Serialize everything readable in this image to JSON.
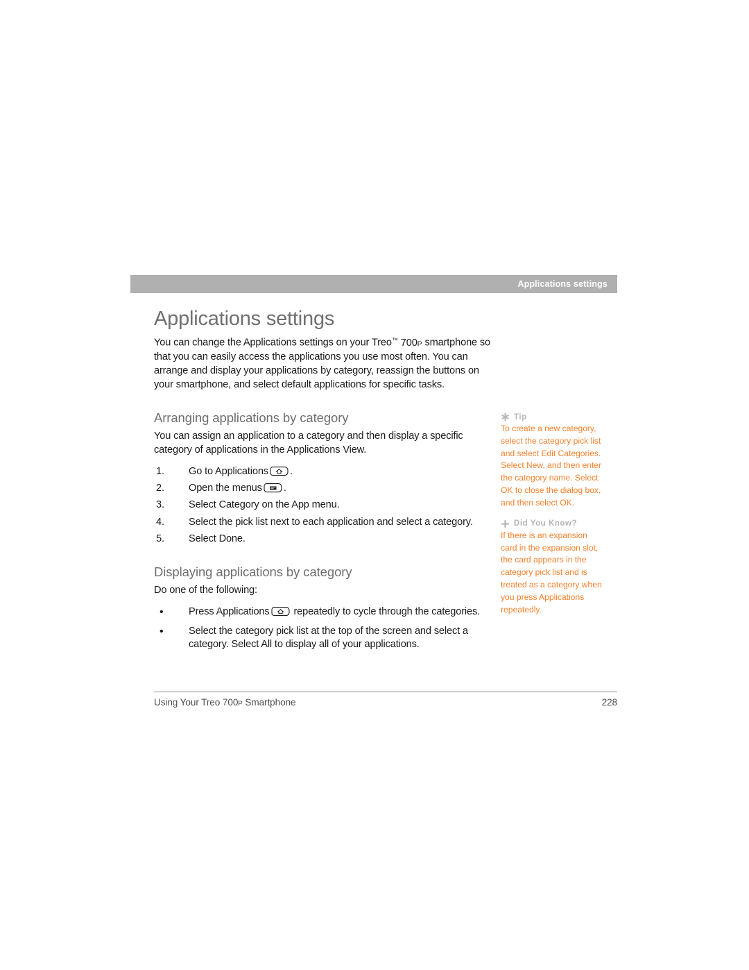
{
  "running_head": {
    "text": "Applications settings",
    "bar_color": "#b0b0b0",
    "text_color": "#ffffff"
  },
  "page_title": "Applications settings",
  "intro": {
    "before_product": "You can change the Applications settings on your Treo",
    "trademark": "™",
    "product_number": "700",
    "product_suffix": "P",
    "after_product": "smartphone so that you can easily access the applications you use most often. You can arrange and display your applications by category, reassign the buttons on your smartphone, and select default applications for specific tasks."
  },
  "sections": [
    {
      "title": "Arranging applications by category",
      "intro": "You can assign an application to a category and then display a specific category of applications in the Applications View.",
      "list_type": "ordered",
      "items": [
        {
          "marker": "1.",
          "before": "Go to Applications",
          "icon": "home-key-icon",
          "after": "."
        },
        {
          "marker": "2.",
          "before": "Open the menus",
          "icon": "menu-key-icon",
          "after": "."
        },
        {
          "marker": "3.",
          "before": "Select Category on the App menu.",
          "icon": null,
          "after": ""
        },
        {
          "marker": "4.",
          "before": "Select the pick list next to each application and select a category.",
          "icon": null,
          "after": ""
        },
        {
          "marker": "5.",
          "before": "Select Done.",
          "icon": null,
          "after": ""
        }
      ]
    },
    {
      "title": "Displaying applications by category",
      "intro": "Do one of the following:",
      "list_type": "bulleted",
      "items": [
        {
          "marker": "•",
          "before": "Press Applications",
          "icon": "home-key-icon",
          "after": "repeatedly to cycle through the categories."
        },
        {
          "marker": "•",
          "before": "Select the category pick list at the top of the screen and select a category. Select All to display all of your applications.",
          "icon": null,
          "after": ""
        }
      ]
    }
  ],
  "sidenotes": [
    {
      "icon": "asterisk-icon",
      "label": "Tip",
      "body": "To create a new category, select the category pick list and select Edit Categories. Select New, and then enter the category name. Select OK to close the dialog box, and then select OK."
    },
    {
      "icon": "plus-icon",
      "label": "Did You Know?",
      "body": "If there is an expansion card in the expansion slot, the card appears in the category pick list and is treated as a category when you press Applications repeatedly."
    }
  ],
  "footer": {
    "left_before": "Using Your Treo ",
    "left_number": "700",
    "left_suffix": "P",
    "left_after": " Smartphone",
    "page_number": "228"
  },
  "colors": {
    "accent_orange": "#f5822e",
    "heading_gray": "#6f6f6f",
    "note_label_gray": "#b5b5b5",
    "bar_gray": "#b0b0b0"
  }
}
